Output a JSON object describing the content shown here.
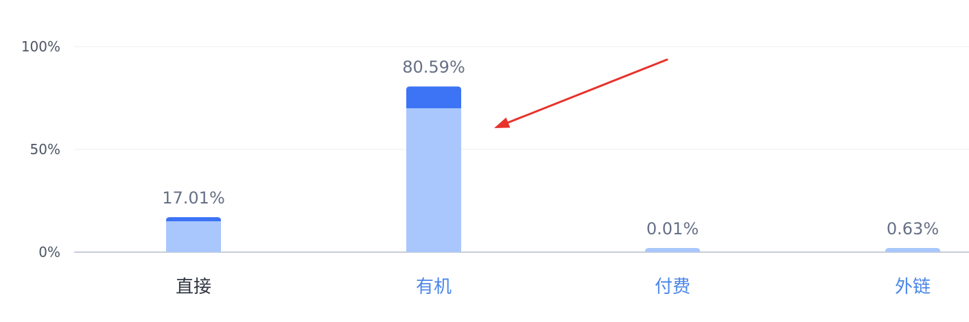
{
  "chart_data": {
    "type": "bar",
    "categories": [
      "直接",
      "有机",
      "付费",
      "外链"
    ],
    "values": [
      17.01,
      80.59,
      0.01,
      0.63
    ],
    "highlight_values": [
      15,
      70,
      0.01,
      0.63
    ],
    "value_labels": [
      "17.01%",
      "80.59%",
      "0.01%",
      "0.63%"
    ],
    "y_ticks": [
      {
        "value": 0,
        "label": "0%"
      },
      {
        "value": 50,
        "label": "50%"
      },
      {
        "value": 100,
        "label": "100%"
      }
    ],
    "ylim": [
      0,
      100
    ],
    "grid": true,
    "title": "",
    "xlabel": "",
    "ylabel": ""
  },
  "colors": {
    "bar_top": "#3d74f5",
    "bar_bottom": "#a9c7fd",
    "category_active": "#2f3541",
    "category_link": "#4a86e8",
    "grid": "#eeeeee",
    "axis": "#c8ccd6",
    "annotation_arrow": "#e8312a"
  },
  "annotation": {
    "icon": "arrow-icon"
  },
  "category_styles": [
    "active",
    "link",
    "link",
    "link"
  ]
}
